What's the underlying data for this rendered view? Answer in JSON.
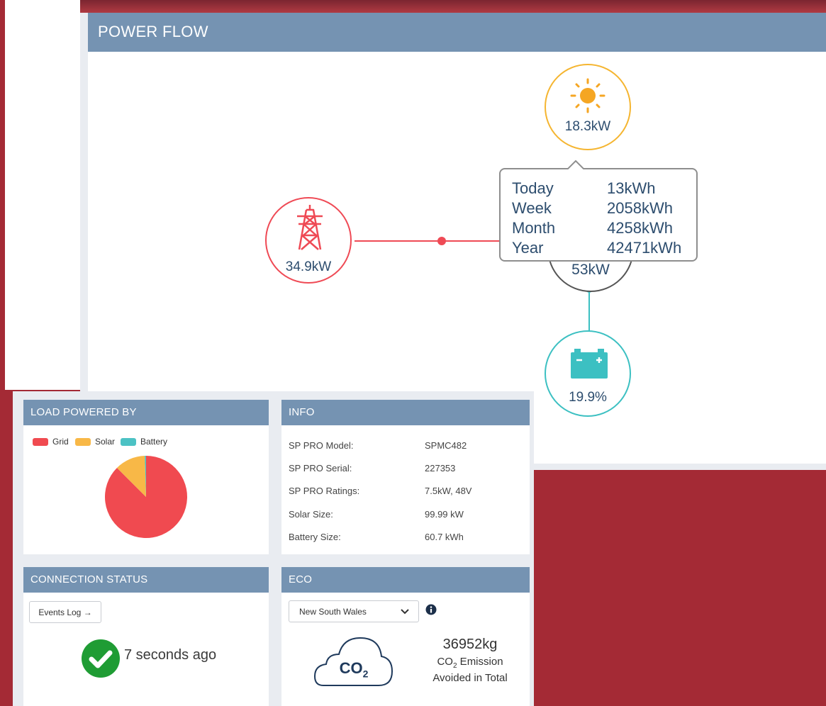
{
  "power_flow": {
    "title": "POWER FLOW",
    "solar": {
      "value": "18.3kW",
      "icon": "sun-icon",
      "color": "#f5b530"
    },
    "grid": {
      "value": "34.9kW",
      "icon": "transmission-tower-icon",
      "color": "#ef4a55"
    },
    "load": {
      "value": "53kW"
    },
    "battery": {
      "value": "19.9%",
      "icon": "battery-icon",
      "color": "#3cc0c2"
    },
    "tooltip": {
      "rows": [
        {
          "label": "Today",
          "value": "13kWh"
        },
        {
          "label": "Week",
          "value": "2058kWh"
        },
        {
          "label": "Month",
          "value": "4258kWh"
        },
        {
          "label": "Year",
          "value": "42471kWh"
        }
      ]
    }
  },
  "load_powered_by": {
    "title": "LOAD POWERED BY",
    "legend": [
      {
        "label": "Grid",
        "color": "#f04a50"
      },
      {
        "label": "Solar",
        "color": "#f8b847"
      },
      {
        "label": "Battery",
        "color": "#4cc2c4"
      }
    ],
    "chart_data": {
      "type": "pie",
      "categories": [
        "Grid",
        "Solar",
        "Battery"
      ],
      "values": [
        87.5,
        12,
        0.5
      ]
    }
  },
  "info": {
    "title": "INFO",
    "rows": [
      {
        "label": "SP PRO Model:",
        "value": "SPMC482"
      },
      {
        "label": "SP PRO Serial:",
        "value": "227353"
      },
      {
        "label": "SP PRO Ratings:",
        "value": "7.5kW, 48V"
      },
      {
        "label": "Solar Size:",
        "value": "99.99 kW"
      },
      {
        "label": "Battery Size:",
        "value": "60.7 kWh"
      }
    ]
  },
  "connection_status": {
    "title": "CONNECTION STATUS",
    "events_button": "Events Log →",
    "status_text": "7 seconds ago",
    "status_color": "#1f9c34"
  },
  "eco": {
    "title": "ECO",
    "region": "New South Wales",
    "co2_icon_text": "CO",
    "co2_icon_sub": "2",
    "amount": "36952kg",
    "line1_pre": "CO",
    "line1_sub": "2",
    "line1_post": " Emission",
    "line2": "Avoided in Total"
  }
}
